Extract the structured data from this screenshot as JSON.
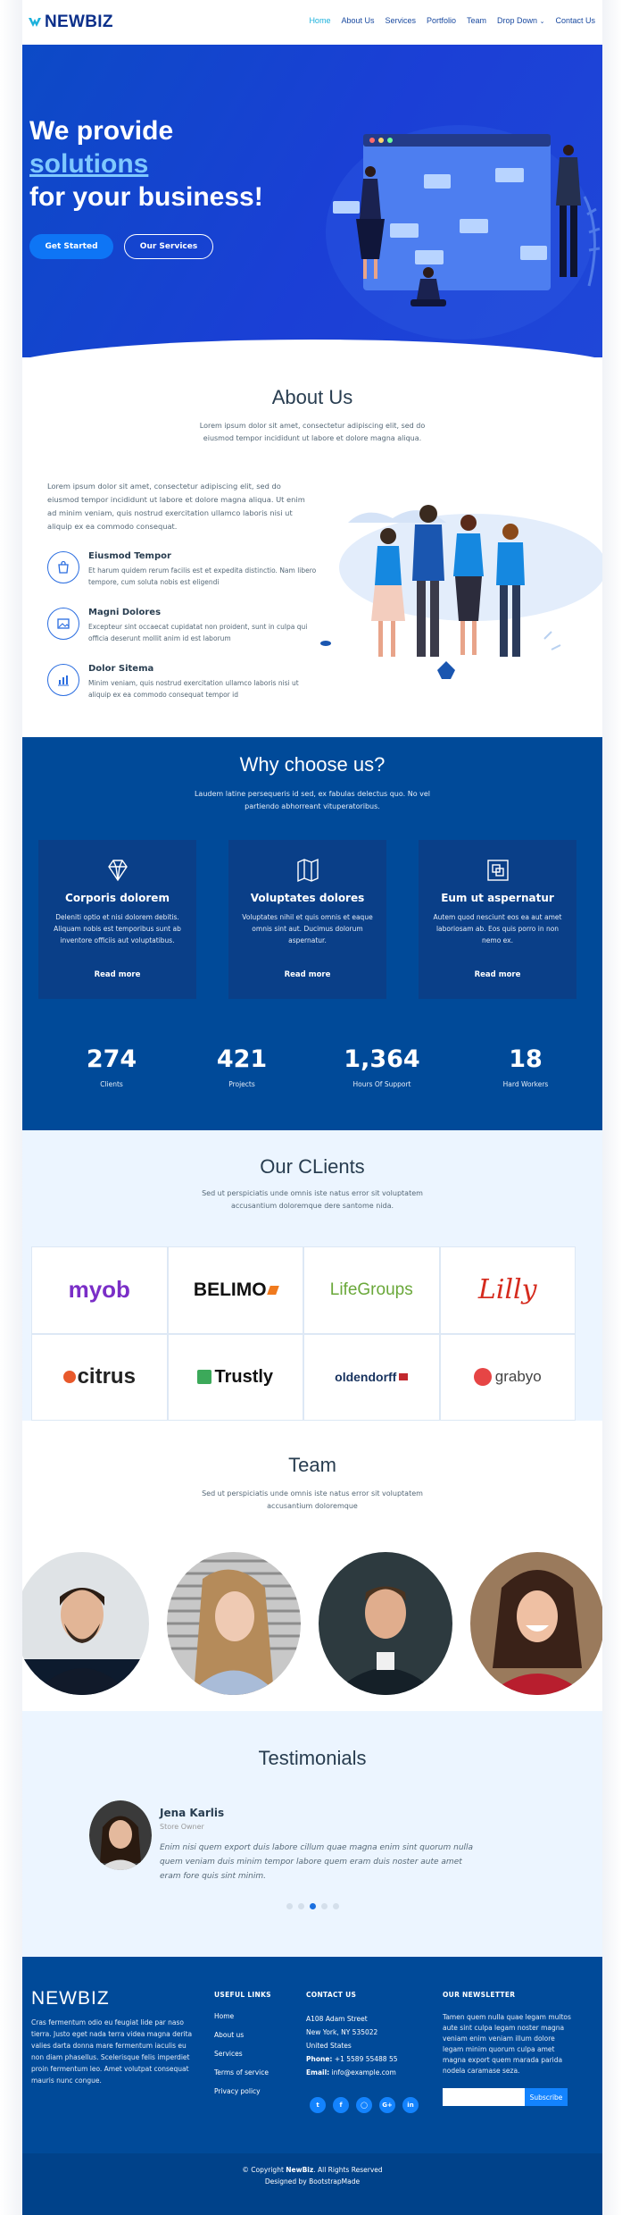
{
  "header": {
    "logo": "NEWBIZ",
    "nav": [
      "Home",
      "About Us",
      "Services",
      "Portfolio",
      "Team",
      "Drop Down",
      "Contact Us"
    ],
    "active_nav": "Home"
  },
  "hero": {
    "line1": "We provide",
    "line2": "solutions",
    "line3": "for your business!",
    "btn_start": "Get Started",
    "btn_services": "Our Services"
  },
  "about": {
    "title": "About Us",
    "subtitle": "Lorem ipsum dolor sit amet, consectetur adipiscing elit, sed do eiusmod tempor incididunt ut labore et dolore magna aliqua.",
    "paragraph": "Lorem ipsum dolor sit amet, consectetur adipiscing elit, sed do eiusmod tempor incididunt ut labore et dolore magna aliqua. Ut enim ad minim veniam, quis nostrud exercitation ullamco laboris nisi ut aliquip ex ea commodo consequat.",
    "features": [
      {
        "title": "Eiusmod Tempor",
        "text": "Et harum quidem rerum facilis est et expedita distinctio. Nam libero tempore, cum soluta nobis est eligendi",
        "icon": "shopping-bag-icon"
      },
      {
        "title": "Magni Dolores",
        "text": "Excepteur sint occaecat cupidatat non proident, sunt in culpa qui officia deserunt mollit anim id est laborum",
        "icon": "image-icon"
      },
      {
        "title": "Dolor Sitema",
        "text": "Minim veniam, quis nostrud exercitation ullamco laboris nisi ut aliquip ex ea commodo consequat tempor id",
        "icon": "bar-chart-icon"
      }
    ]
  },
  "why": {
    "title": "Why choose us?",
    "subtitle": "Laudem latine persequeris id sed, ex fabulas delectus quo. No vel partiendo abhorreant vituperatoribus.",
    "cards": [
      {
        "title": "Corporis dolorem",
        "text": "Deleniti optio et nisi dolorem debitis. Aliquam nobis est temporibus sunt ab inventore officiis aut voluptatibus.",
        "link": "Read more",
        "icon": "diamond-icon"
      },
      {
        "title": "Voluptates dolores",
        "text": "Voluptates nihil et quis omnis et eaque omnis sint aut. Ducimus dolorum aspernatur.",
        "link": "Read more",
        "icon": "map-icon"
      },
      {
        "title": "Eum ut aspernatur",
        "text": "Autem quod nesciunt eos ea aut amet laboriosam ab. Eos quis porro in non nemo ex.",
        "link": "Read more",
        "icon": "layers-icon"
      }
    ],
    "stats": [
      {
        "number": "274",
        "label": "Clients"
      },
      {
        "number": "421",
        "label": "Projects"
      },
      {
        "number": "1,364",
        "label": "Hours Of Support"
      },
      {
        "number": "18",
        "label": "Hard Workers"
      }
    ]
  },
  "clients": {
    "title": "Our CLients",
    "subtitle": "Sed ut perspiciatis unde omnis iste natus error sit voluptatem accusantium doloremque dere santome nida.",
    "logos": [
      "myob",
      "BELIMO",
      "LifeGroups",
      "Lilly",
      "citrus",
      "Trustly",
      "oldendorff",
      "grabyo"
    ]
  },
  "team": {
    "title": "Team",
    "subtitle": "Sed ut perspiciatis unde omnis iste natus error sit voluptatem accusantium doloremque"
  },
  "testimonials": {
    "title": "Testimonials",
    "name": "Jena Karlis",
    "role": "Store Owner",
    "quote": "Enim nisi quem export duis labore cillum quae magna enim sint quorum nulla quem veniam duis minim tempor labore quem eram duis noster aute amet eram fore quis sint minim."
  },
  "footer": {
    "logo": "NEWBIZ",
    "about": "Cras fermentum odio eu feugiat lide par naso tierra. Justo eget nada terra videa magna derita valies darta donna mare fermentum iaculis eu non diam phasellus. Scelerisque felis imperdiet proin fermentum leo. Amet volutpat consequat mauris nunc congue.",
    "useful_links_title": "USEFUL LINKS",
    "useful_links": [
      "Home",
      "About us",
      "Services",
      "Terms of service",
      "Privacy policy"
    ],
    "contact_title": "CONTACT US",
    "address1": "A108 Adam Street",
    "address2": "New York, NY 535022",
    "address3": "United States",
    "phone_label": "Phone:",
    "phone": "+1 5589 55488 55",
    "email_label": "Email:",
    "email": "info@example.com",
    "newsletter_title": "OUR NEWSLETTER",
    "newsletter_text": "Tamen quem nulla quae legam multos aute sint culpa legam noster magna veniam enim veniam illum dolore legam minim quorum culpa amet magna export quem marada parida nodela caramase seza.",
    "subscribe": "Subscribe",
    "copyright_prefix": "© Copyright ",
    "copyright_brand": "NewBiz",
    "copyright_suffix": ". All Rights Reserved",
    "designed": "Designed by BootstrapMade"
  },
  "colors": {
    "primary": "#004a99",
    "accent": "#1383fe",
    "hero": "#1b3fd6",
    "light_bg": "#ecf5ff"
  }
}
